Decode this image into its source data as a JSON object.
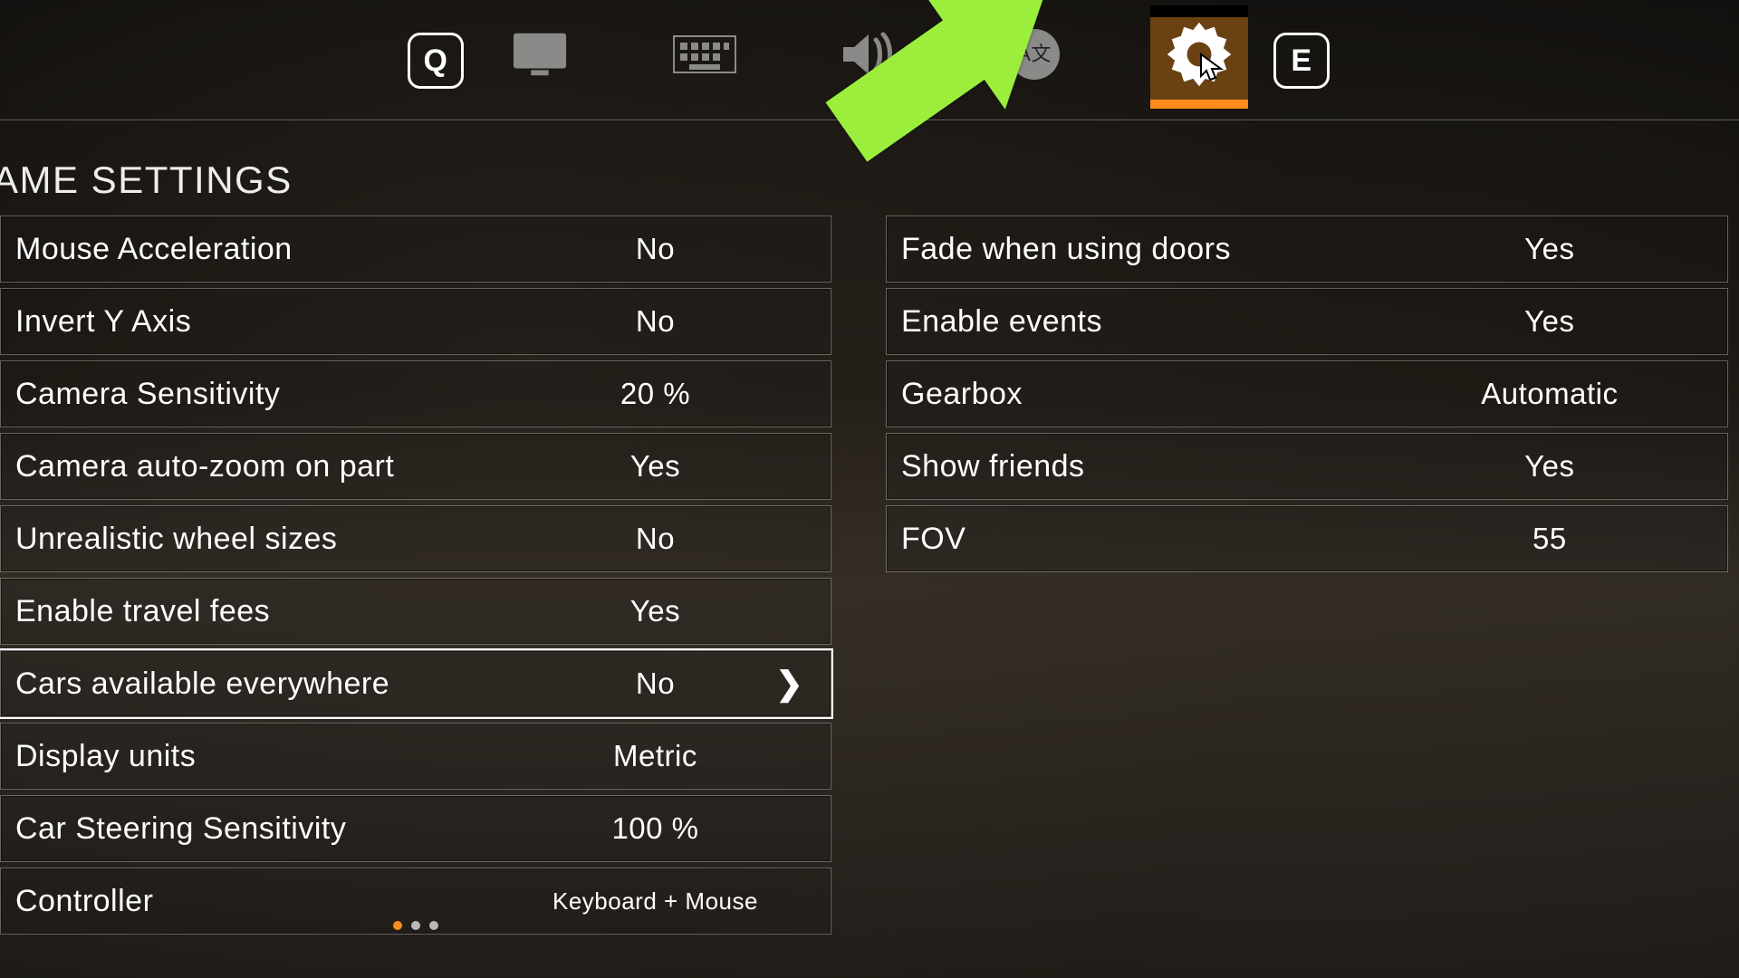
{
  "key_hints": {
    "prev": "Q",
    "next": "E"
  },
  "section_title": "AME SETTINGS",
  "tabs": [
    {
      "id": "display",
      "icon": "monitor",
      "active": false
    },
    {
      "id": "controls",
      "icon": "keyboard",
      "active": false
    },
    {
      "id": "audio",
      "icon": "speaker",
      "active": false
    },
    {
      "id": "language",
      "icon": "globe-a",
      "active": false
    },
    {
      "id": "game",
      "icon": "gear",
      "active": true
    }
  ],
  "settings_left": [
    {
      "label": "Mouse Acceleration",
      "value": "No"
    },
    {
      "label": "Invert Y Axis",
      "value": "No"
    },
    {
      "label": "Camera Sensitivity",
      "value": "20 %"
    },
    {
      "label": "Camera auto-zoom on part",
      "value": "Yes"
    },
    {
      "label": "Unrealistic wheel sizes",
      "value": "No"
    },
    {
      "label": "Enable travel fees",
      "value": "Yes"
    },
    {
      "label": "Cars available everywhere",
      "value": "No",
      "focused": true,
      "has_chevron": true
    },
    {
      "label": "Display units",
      "value": "Metric"
    },
    {
      "label": "Car Steering Sensitivity",
      "value": "100 %"
    },
    {
      "label": "Controller",
      "value": "Keyboard + Mouse",
      "small": true,
      "dots": [
        true,
        false,
        false
      ]
    }
  ],
  "settings_right": [
    {
      "label": "Fade when using doors",
      "value": "Yes"
    },
    {
      "label": "Enable events",
      "value": "Yes"
    },
    {
      "label": "Gearbox",
      "value": "Automatic"
    },
    {
      "label": "Show friends",
      "value": "Yes"
    },
    {
      "label": "FOV",
      "value": "55"
    }
  ]
}
